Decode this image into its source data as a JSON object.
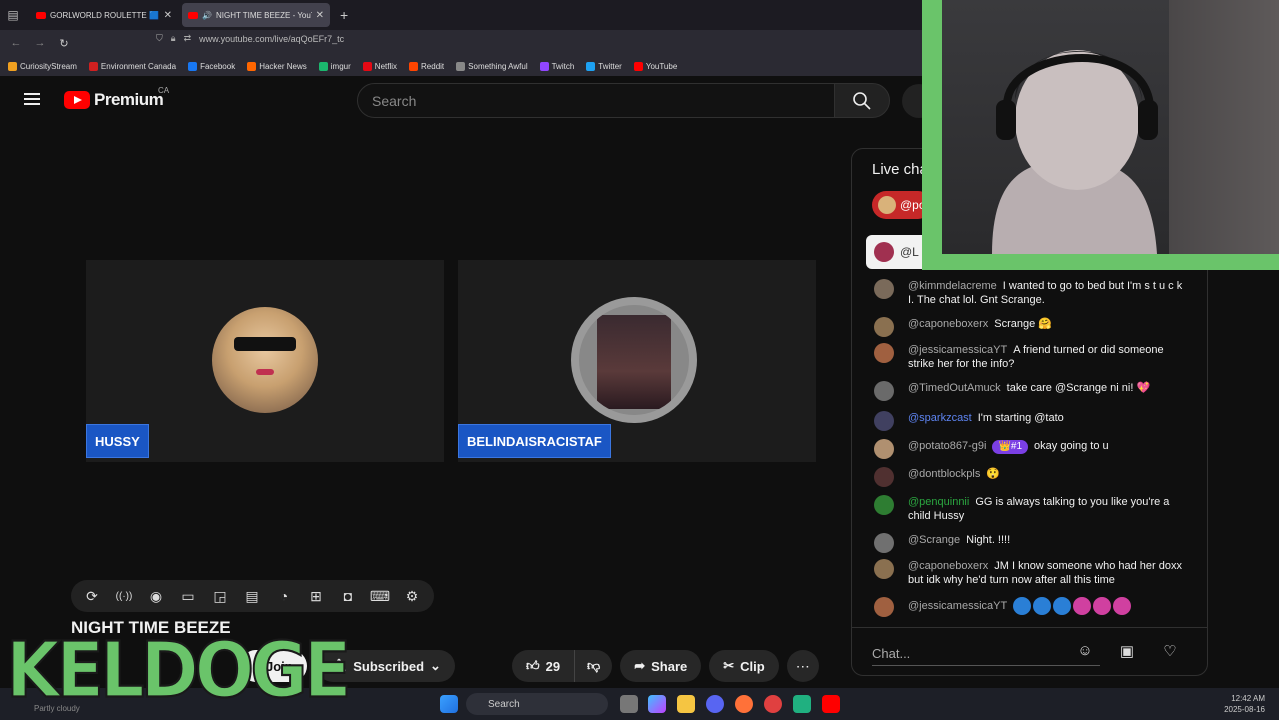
{
  "browser": {
    "tabs": [
      {
        "title": "GORLWORLD ROULETTE 🟦 W",
        "active": false
      },
      {
        "title": "NIGHT TIME BEEZE - YouTu",
        "active": true
      }
    ],
    "new_tab": "+",
    "url": "www.youtube.com/live/aqQoEFr7_tc",
    "bookmarks": [
      {
        "label": "CuriosityStream",
        "color": "#f0a020"
      },
      {
        "label": "Environment Canada",
        "color": "#d02020"
      },
      {
        "label": "Facebook",
        "color": "#1877f2"
      },
      {
        "label": "Hacker News",
        "color": "#ff6600"
      },
      {
        "label": "imgur",
        "color": "#1bb76e"
      },
      {
        "label": "Netflix",
        "color": "#e50914"
      },
      {
        "label": "Reddit",
        "color": "#ff4500"
      },
      {
        "label": "Something Awful",
        "color": "#888888"
      },
      {
        "label": "Twitch",
        "color": "#9146ff"
      },
      {
        "label": "Twitter",
        "color": "#1da1f2"
      },
      {
        "label": "YouTube",
        "color": "#ff0000"
      }
    ]
  },
  "youtube": {
    "logo_text": "Premium",
    "region": "CA",
    "search_placeholder": "Search"
  },
  "player": {
    "participants": [
      {
        "name": "HUSSY"
      },
      {
        "name": "BELINDAISRACISTAF"
      }
    ],
    "controls": [
      "loop-icon",
      "live-audio-icon",
      "view-icon",
      "clapper-icon",
      "pip-icon",
      "captions-icon",
      "speed-icon",
      "add-icon",
      "camera-icon",
      "keyboard-icon",
      "settings-icon"
    ]
  },
  "video": {
    "title": "NIGHT TIME BEEZE",
    "join_label": "Join",
    "subscribed_label": "Subscribed",
    "like_count": "29",
    "share_label": "Share",
    "clip_label": "Clip",
    "more_label": "⋯"
  },
  "chat": {
    "header": "Live cha",
    "pinned_chip": "@po",
    "banner_text": "@L",
    "messages": [
      {
        "author": "@kimmdelacreme",
        "text": "I wanted to go to bed but I'm s t u c k I. The chat lol. Gnt Scrange.",
        "color": "#aaaaaa",
        "avatar": "#7a6a5a"
      },
      {
        "author": "@caponeboxerx",
        "text": "Scrange 🤗",
        "color": "#aaaaaa",
        "avatar": "#8a7050"
      },
      {
        "author": "@jessicamessicaYT",
        "text": "A friend turned or did someone strike her for the info?",
        "color": "#aaaaaa",
        "avatar": "#a06040"
      },
      {
        "author": "@TimedOutAmuck",
        "text": "take care @Scrange ni ni! 💖",
        "color": "#aaaaaa",
        "avatar": "#6a6a6a"
      },
      {
        "author": "@sparkzcast",
        "text": "I'm starting @tato",
        "color": "#5e84f1",
        "avatar": "#404060"
      },
      {
        "author": "@potato867-g9i",
        "badge": "👑#1",
        "text": "okay going to u",
        "color": "#aaaaaa",
        "avatar": "#b09070"
      },
      {
        "author": "@dontblockpls",
        "text": "😲",
        "color": "#aaaaaa",
        "avatar": "#503030"
      },
      {
        "author": "@penquinnii",
        "text": "GG is always talking to you like you're a child Hussy",
        "color": "#2ba640",
        "avatar": "#2e7d32"
      },
      {
        "author": "@Scrange",
        "text": "Night. !!!!",
        "color": "#aaaaaa",
        "avatar": "#707070"
      },
      {
        "author": "@caponeboxerx",
        "text": "JM I know someone who had her doxx but idk why he'd turn now after all this time",
        "color": "#aaaaaa",
        "avatar": "#8a7050"
      },
      {
        "author": "@jessicamessicaYT",
        "text": "",
        "color": "#aaaaaa",
        "avatar": "#a06040"
      }
    ],
    "input_placeholder": "Chat..."
  },
  "overlay": {
    "brand": "KELDOGE",
    "now_playing": "Partly cloudy"
  },
  "taskbar": {
    "search_placeholder": "Search",
    "time": "12:42 AM",
    "date": "2025-08-16"
  }
}
